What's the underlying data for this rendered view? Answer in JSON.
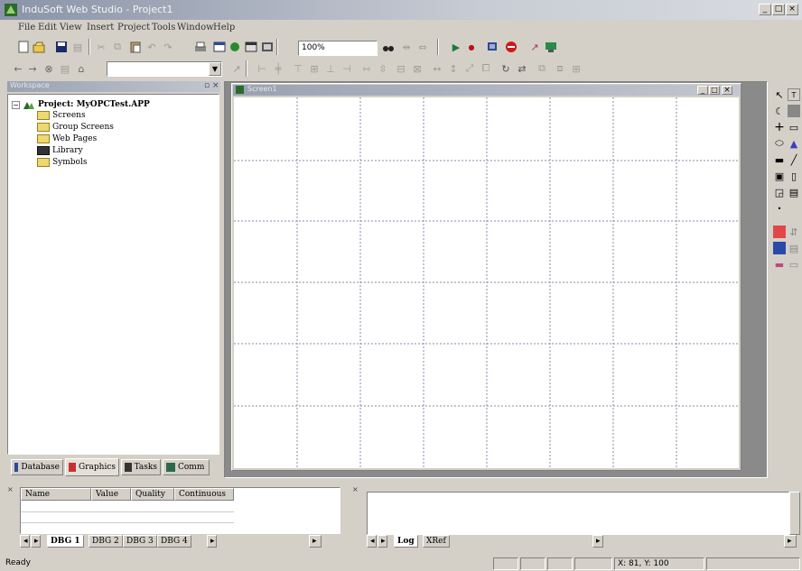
{
  "window": {
    "title": "InduSoft Web Studio - Project1",
    "min": "_",
    "max": "□",
    "close": "×"
  },
  "menu": [
    "File",
    "Edit",
    "View",
    "Insert",
    "Project",
    "Tools",
    "Window",
    "Help"
  ],
  "toolbar": {
    "zoom_value": "100%",
    "nav_combo_value": ""
  },
  "workspace": {
    "title": "Workspace",
    "project_label": "Project: MyOPCTest.APP",
    "items": [
      "Screens",
      "Group Screens",
      "Web Pages",
      "Library",
      "Symbols"
    ],
    "tabs": [
      "Database",
      "Graphics",
      "Tasks",
      "Comm"
    ]
  },
  "screen_window": {
    "title": "Screen1",
    "min": "_",
    "max": "□",
    "close": "×"
  },
  "db_panel": {
    "columns": [
      "Name",
      "Value",
      "Quality",
      "Continuous"
    ],
    "tabs": [
      "DBG 1",
      "DBG 2",
      "DBG 3",
      "DBG 4"
    ]
  },
  "log_panel": {
    "tabs": [
      "Log",
      "XRef"
    ]
  },
  "status": {
    "text": "Ready",
    "coords": "X: 81, Y: 100"
  }
}
